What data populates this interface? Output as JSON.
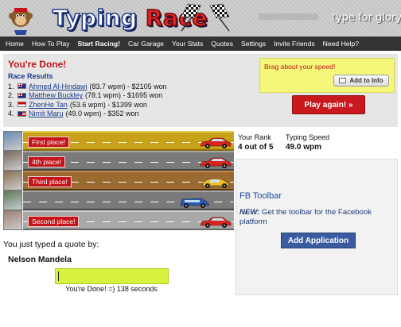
{
  "header": {
    "logo_part1": "Typing",
    "logo_part2": "Race",
    "tagline": "type for glory"
  },
  "nav": [
    "Home",
    "How To Play",
    "Start Racing!",
    "Car Garage",
    "Your Stats",
    "Quotes",
    "Settings",
    "Invite Friends",
    "Need Help?"
  ],
  "nav_active": "Start Racing!",
  "results": {
    "title": "You're Done!",
    "subtitle": "Race Results",
    "rows": [
      {
        "rank": "1.",
        "flag": "au",
        "name": "Ahmed Al-Hindawi",
        "detail": "(83.7 wpm) - $2105 won"
      },
      {
        "rank": "2.",
        "flag": "au",
        "name": "Matthew Buckley",
        "detail": "(78.1 wpm) - $1695 won"
      },
      {
        "rank": "3.",
        "flag": "sg",
        "name": "ZhenHe Tan",
        "detail": "(53.6 wpm) - $1399 won"
      },
      {
        "rank": "4.",
        "flag": "us",
        "name": "Nimit Maru",
        "detail": "(49.0 wpm) - $352 won"
      }
    ],
    "brag_text": "Brag about your speed!",
    "add_info_label": "Add to Info",
    "play_again_label": "Play again! »"
  },
  "lanes": [
    {
      "place": "First place!",
      "road": "gold",
      "car_color": "#d8261e",
      "car_type": "sedan",
      "progress": 1.0
    },
    {
      "place": "4th place!",
      "road": "gray",
      "car_color": "#d8261e",
      "car_type": "sedan",
      "progress": 1.0
    },
    {
      "place": "Third place!",
      "road": "brown",
      "car_color": "#f0c020",
      "car_type": "beetle",
      "progress": 1.0
    },
    {
      "place": "",
      "road": "gray",
      "car_color": "#2a5ab8",
      "car_type": "van",
      "progress": 0.88
    },
    {
      "place": "Second place!",
      "road": "silver",
      "car_color": "#d8261e",
      "car_type": "sedan",
      "progress": 1.0
    }
  ],
  "stats": {
    "rank_label": "Your Rank",
    "rank_value": "4 out of 5",
    "speed_label": "Typing Speed",
    "speed_value": "49.0 wpm"
  },
  "fb": {
    "title": "FB Toolbar",
    "desc_bold": "NEW:",
    "desc": " Get the toolbar for the Facebook platform",
    "button": "Add Application"
  },
  "quote": {
    "intro": "You just typed a quote by:",
    "author": "Nelson Mandela",
    "done_text": "You're Done! =) 138 seconds"
  }
}
